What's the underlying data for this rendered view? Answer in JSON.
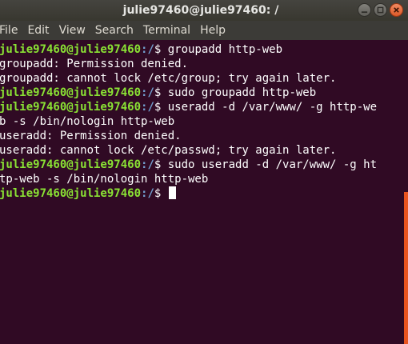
{
  "window": {
    "title": "julie97460@julie97460: /",
    "buttons": [
      {
        "name": "minimize-icon"
      },
      {
        "name": "maximize-icon"
      },
      {
        "name": "close-icon"
      }
    ]
  },
  "menu": [
    "File",
    "Edit",
    "View",
    "Search",
    "Terminal",
    "Help"
  ],
  "prompt": {
    "user_host": "julie97460@julie97460",
    "path": ":/",
    "symbol": "$ "
  },
  "lines": [
    {
      "type": "prompt",
      "text": "groupadd http-web"
    },
    {
      "type": "output",
      "text": "groupadd: Permission denied."
    },
    {
      "type": "output",
      "text": "groupadd: cannot lock /etc/group; try again later."
    },
    {
      "type": "prompt",
      "text": "sudo groupadd http-web"
    },
    {
      "type": "prompt",
      "text": "useradd -d /var/www/ -g http-we"
    },
    {
      "type": "output",
      "text": "b -s /bin/nologin http-web"
    },
    {
      "type": "output",
      "text": "useradd: Permission denied."
    },
    {
      "type": "output",
      "text": "useradd: cannot lock /etc/passwd; try again later."
    },
    {
      "type": "prompt",
      "text": "sudo useradd -d /var/www/ -g ht"
    },
    {
      "type": "output",
      "text": "tp-web -s /bin/nologin http-web"
    },
    {
      "type": "prompt",
      "text": ""
    }
  ],
  "colors": {
    "background": "#300a24",
    "prompt_user": "#8ae234",
    "prompt_path": "#729fcf",
    "scrollbar_thumb": "#e95420"
  }
}
